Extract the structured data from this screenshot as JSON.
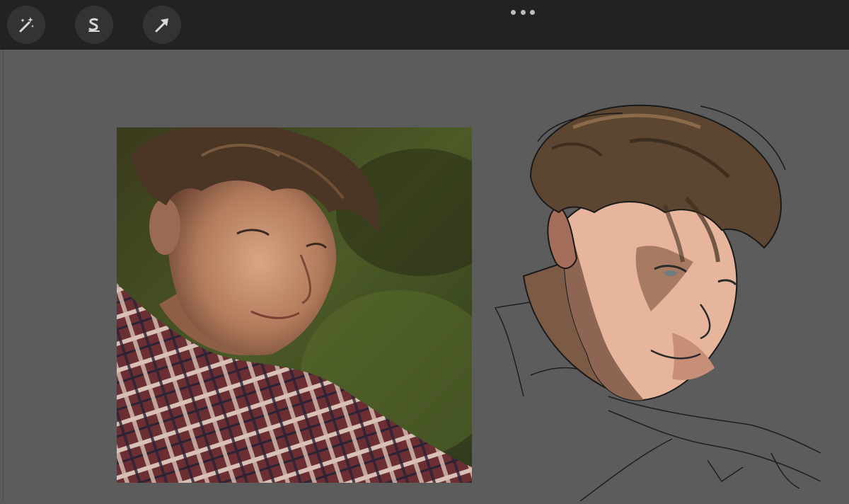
{
  "toolbar": {
    "tools": [
      {
        "name": "adjustments",
        "icon": "magic-wand-icon"
      },
      {
        "name": "selection",
        "icon": "selection-s-icon"
      },
      {
        "name": "transform",
        "icon": "arrow-cursor-icon"
      }
    ],
    "more_icon": "ellipsis-icon"
  },
  "colors": {
    "toolbar_bg": "#222222",
    "canvas_bg": "#5c5c5c",
    "hair": "#5a4530",
    "skin_light": "#e7b99f",
    "skin_shadow": "#8f6a55",
    "shirt_red": "#7a3a3a"
  }
}
